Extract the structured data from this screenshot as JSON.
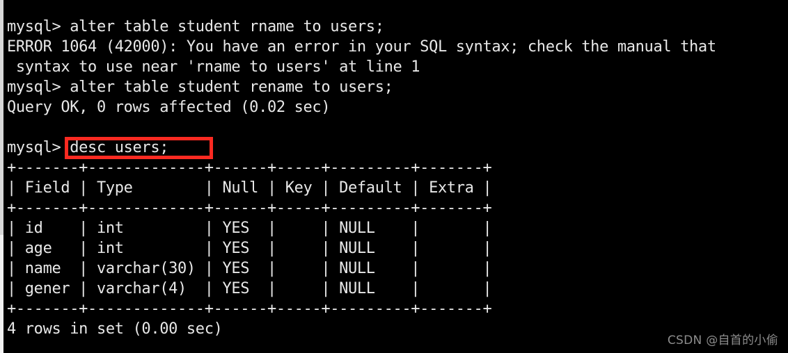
{
  "terminal": {
    "prompt": "mysql>",
    "background_color": "#000000",
    "text_color": "#e8e8e8",
    "highlight_color": "#fb2a21",
    "lines": [
      "mysql> alter table student rname to users;",
      "ERROR 1064 (42000): You have an error in your SQL syntax; check the manual that",
      " syntax to use near 'rname to users' at line 1",
      "mysql> alter table student rename to users;",
      "Query OK, 0 rows affected (0.02 sec)",
      "",
      "mysql> desc users;",
      "+-------+-------------+------+-----+---------+-------+",
      "| Field | Type        | Null | Key | Default | Extra |",
      "+-------+-------------+------+-----+---------+-------+",
      "| id    | int         | YES  |     | NULL    |       |",
      "| age   | int         | YES  |     | NULL    |       |",
      "| name  | varchar(30) | YES  |     | NULL    |       |",
      "| gener | varchar(4)  | YES  |     | NULL    |       |",
      "+-------+-------------+------+-----+---------+-------+",
      "4 rows in set (0.00 sec)"
    ],
    "highlighted_command": "desc users;",
    "error": {
      "code": "ERROR 1064",
      "sqlstate": "(42000)",
      "message": "You have an error in your SQL syntax; check the manual that syntax to use near 'rname to users' at line 1"
    },
    "status_messages": [
      "Query OK, 0 rows affected (0.02 sec)",
      "4 rows in set (0.00 sec)"
    ],
    "result_table": {
      "columns": [
        "Field",
        "Type",
        "Null",
        "Key",
        "Default",
        "Extra"
      ],
      "rows": [
        [
          "id",
          "int",
          "YES",
          "",
          "NULL",
          ""
        ],
        [
          "age",
          "int",
          "YES",
          "",
          "NULL",
          ""
        ],
        [
          "name",
          "varchar(30)",
          "YES",
          "",
          "NULL",
          ""
        ],
        [
          "gener",
          "varchar(4)",
          "YES",
          "",
          "NULL",
          ""
        ]
      ],
      "row_count": "4 rows in set (0.00 sec)"
    }
  },
  "watermark": {
    "text": "CSDN @自首的小偷"
  }
}
